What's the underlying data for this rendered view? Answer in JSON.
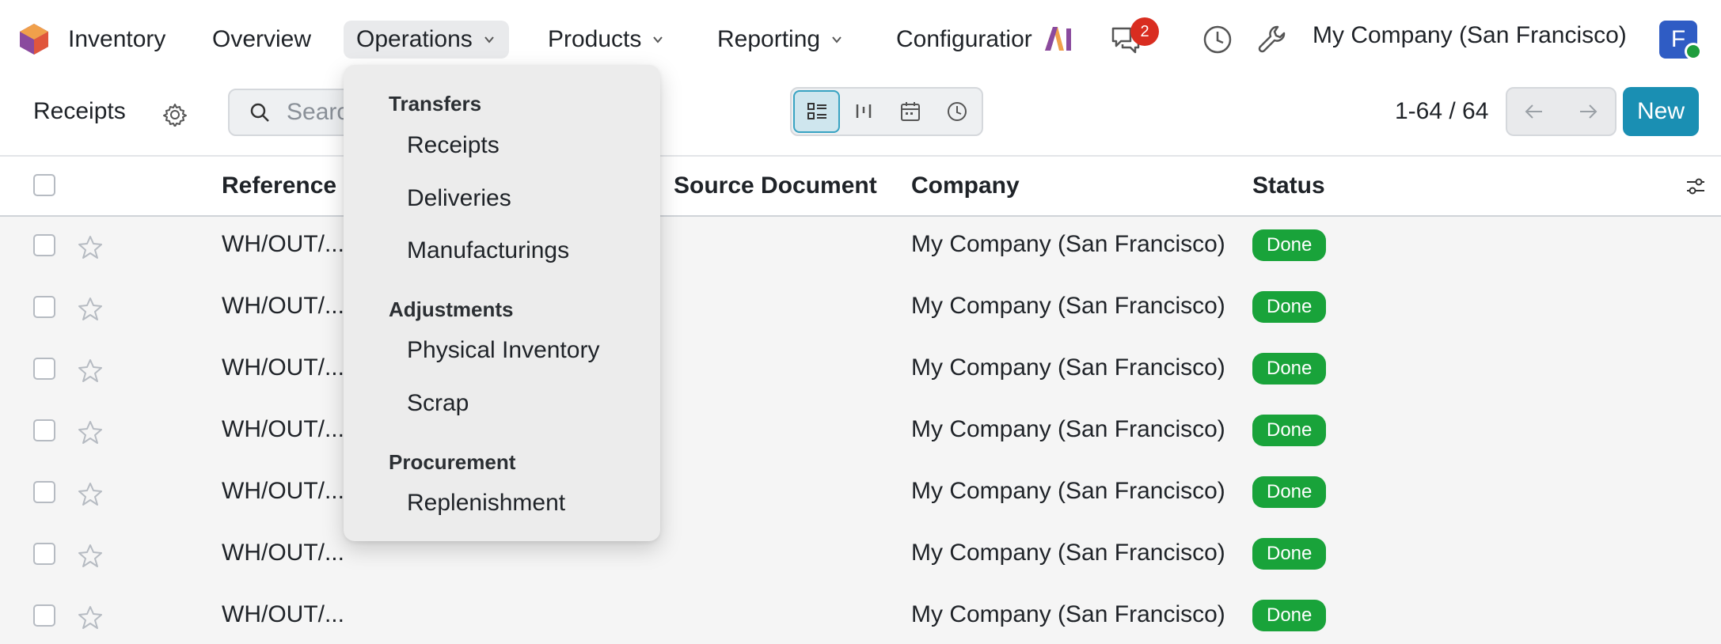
{
  "navbar": {
    "app_name": "Inventory",
    "menus": [
      {
        "label": "Overview"
      },
      {
        "label": "Operations"
      },
      {
        "label": "Products"
      },
      {
        "label": "Reporting"
      },
      {
        "label": "Configuratior"
      }
    ],
    "messages_badge": "2",
    "company": "My Company (San Francisco)",
    "avatar_initial": "F"
  },
  "control_panel": {
    "breadcrumb": "Receipts",
    "search_placeholder": "Search...",
    "pager": "1-64 / 64",
    "new_button": "New",
    "active_view": "list"
  },
  "dropdown": {
    "sections": [
      {
        "header": "Transfers",
        "items": [
          "Receipts",
          "Deliveries",
          "Manufacturings"
        ]
      },
      {
        "header": "Adjustments",
        "items": [
          "Physical Inventory",
          "Scrap"
        ]
      },
      {
        "header": "Procurement",
        "items": [
          "Replenishment"
        ]
      }
    ]
  },
  "table": {
    "columns": [
      "Reference",
      "Source Document",
      "Company",
      "Status"
    ],
    "rows": [
      {
        "reference": "WH/OUT/...",
        "company": "My Company (San Francisco)",
        "status": "Done"
      },
      {
        "reference": "WH/OUT/...",
        "company": "My Company (San Francisco)",
        "status": "Done"
      },
      {
        "reference": "WH/OUT/...",
        "company": "My Company (San Francisco)",
        "status": "Done"
      },
      {
        "reference": "WH/OUT/...",
        "company": "My Company (San Francisco)",
        "status": "Done"
      },
      {
        "reference": "WH/OUT/...",
        "company": "My Company (San Francisco)",
        "status": "Done"
      },
      {
        "reference": "WH/OUT/...",
        "company": "My Company (San Francisco)",
        "status": "Done"
      },
      {
        "reference": "WH/OUT/...",
        "company": "My Company (San Francisco)",
        "status": "Done"
      }
    ]
  },
  "colors": {
    "primary": "#1a8fb3",
    "done_badge": "#19a33a",
    "notification": "#d92d20",
    "active_nav": "#e9eaec"
  }
}
